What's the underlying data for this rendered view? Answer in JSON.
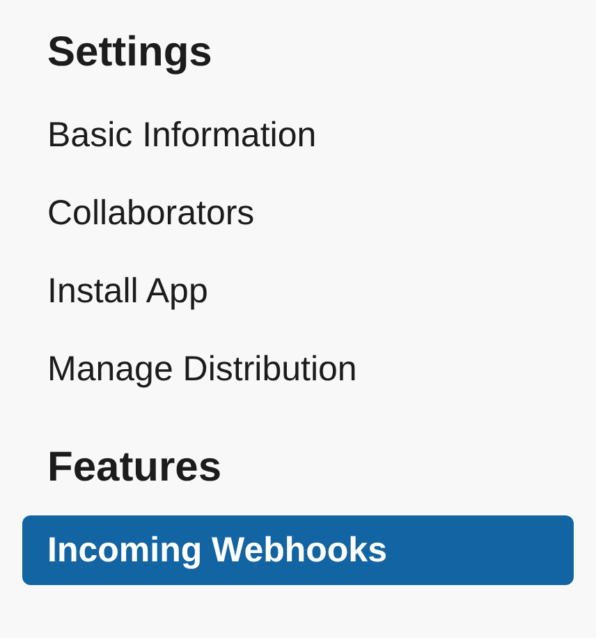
{
  "sections": [
    {
      "heading": "Settings",
      "items": [
        {
          "label": "Basic Information",
          "selected": false
        },
        {
          "label": "Collaborators",
          "selected": false
        },
        {
          "label": "Install App",
          "selected": false
        },
        {
          "label": "Manage Distribution",
          "selected": false
        }
      ]
    },
    {
      "heading": "Features",
      "items": [
        {
          "label": "Incoming Webhooks",
          "selected": true
        }
      ]
    }
  ]
}
